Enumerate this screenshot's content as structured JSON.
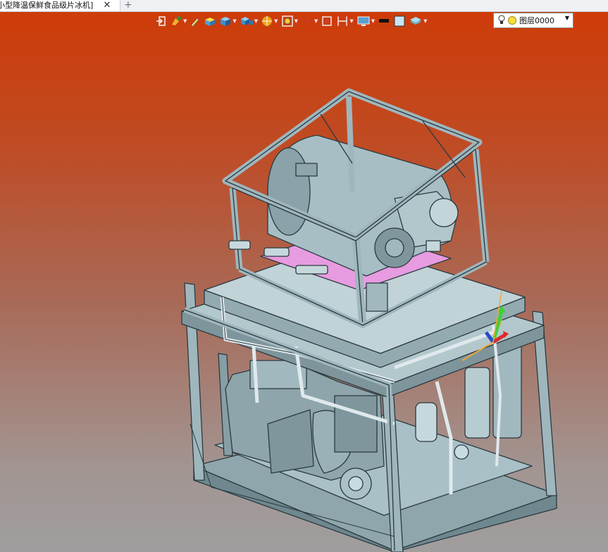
{
  "tab": {
    "title": "小型降温保鲜食品级片冰机]",
    "close": "✕",
    "add": "+"
  },
  "layer": {
    "name": "图层0000"
  },
  "toolbar": {
    "buttons": [
      {
        "name": "exit-icon",
        "caret": false
      },
      {
        "name": "paint-icon",
        "caret": true
      },
      {
        "name": "pen-icon",
        "caret": false
      },
      {
        "name": "box-render-icon",
        "caret": false
      },
      {
        "name": "cube-icon",
        "caret": true
      },
      {
        "name": "multi-cube-icon",
        "caret": true
      },
      {
        "name": "ball-icon",
        "caret": true
      },
      {
        "name": "zoom-view-icon",
        "caret": true
      },
      {
        "name": "axis-icon",
        "caret": true
      },
      {
        "name": "frame-select-icon",
        "caret": false
      },
      {
        "name": "section-icon",
        "caret": true
      },
      {
        "name": "display-icon",
        "caret": true
      },
      {
        "name": "line-color-icon",
        "caret": false
      },
      {
        "name": "fill-color-icon",
        "caret": false
      },
      {
        "name": "layer-stack-icon",
        "caret": true
      }
    ]
  },
  "colors": {
    "background_top": "#cf3a06",
    "background_bottom": "#a09e9e",
    "model": "#9fb6bd",
    "highlight": "#e79be0"
  }
}
